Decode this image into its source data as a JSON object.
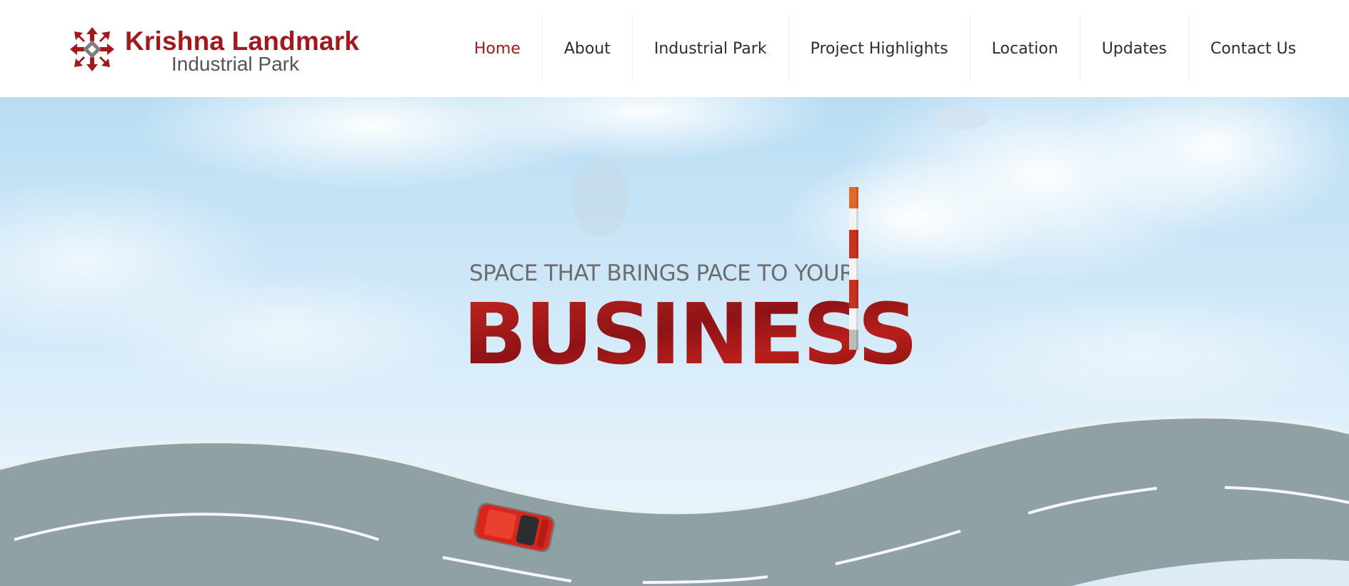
{
  "brand": {
    "title": "Krishna Landmark",
    "subtitle": "Industrial Park",
    "logo_icon": "krishna-emblem-icon",
    "accent_color": "#a3171d"
  },
  "nav": {
    "items": [
      {
        "label": "Home",
        "active": true
      },
      {
        "label": "About",
        "active": false
      },
      {
        "label": "Industrial Park",
        "active": false
      },
      {
        "label": "Project Highlights",
        "active": false
      },
      {
        "label": "Location",
        "active": false
      },
      {
        "label": "Updates",
        "active": false
      },
      {
        "label": "Contact Us",
        "active": false
      }
    ]
  },
  "hero": {
    "tagline": "SPACE THAT BRINGS PACE TO YOUR",
    "headline": "BUSINESS",
    "sky_color": "#cfe8f8",
    "road_color": "#8fa1a5",
    "car_color": "#d9251c"
  }
}
